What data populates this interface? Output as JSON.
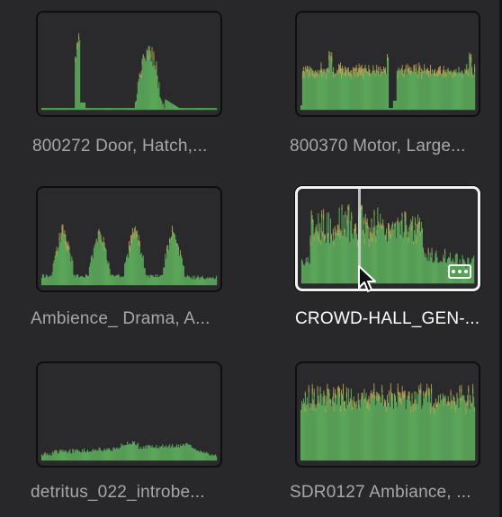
{
  "theme": {
    "panel_bg": "#28282b",
    "thumb_bg": "#2a2a2d",
    "waveform_color": "#5aa55a",
    "peak_color": "#c9a552",
    "selected_border": "#f2f2f2"
  },
  "clips": [
    {
      "label": "800272 Door, Hatch,...",
      "selected": false,
      "shape": "door_hatch",
      "icon": "waveform-thumbnail"
    },
    {
      "label": "800370 Motor, Large...",
      "selected": false,
      "shape": "motor_large",
      "icon": "waveform-thumbnail"
    },
    {
      "label": "Ambience_ Drama, A...",
      "selected": false,
      "shape": "ambience_drama",
      "icon": "waveform-thumbnail"
    },
    {
      "label": "CROWD-HALL_GEN-...",
      "selected": true,
      "shape": "crowd_hall",
      "icon": "waveform-thumbnail"
    },
    {
      "label": "detritus_022_introbe...",
      "selected": false,
      "shape": "detritus",
      "icon": "waveform-thumbnail"
    },
    {
      "label": "SDR0127 Ambiance, ...",
      "selected": false,
      "shape": "sdr_ambiance",
      "icon": "waveform-thumbnail"
    }
  ],
  "selected_clip": {
    "more_options_icon": "ellipsis-icon",
    "playhead_icon": "playhead-line",
    "cursor_icon": "mouse-pointer-icon"
  }
}
